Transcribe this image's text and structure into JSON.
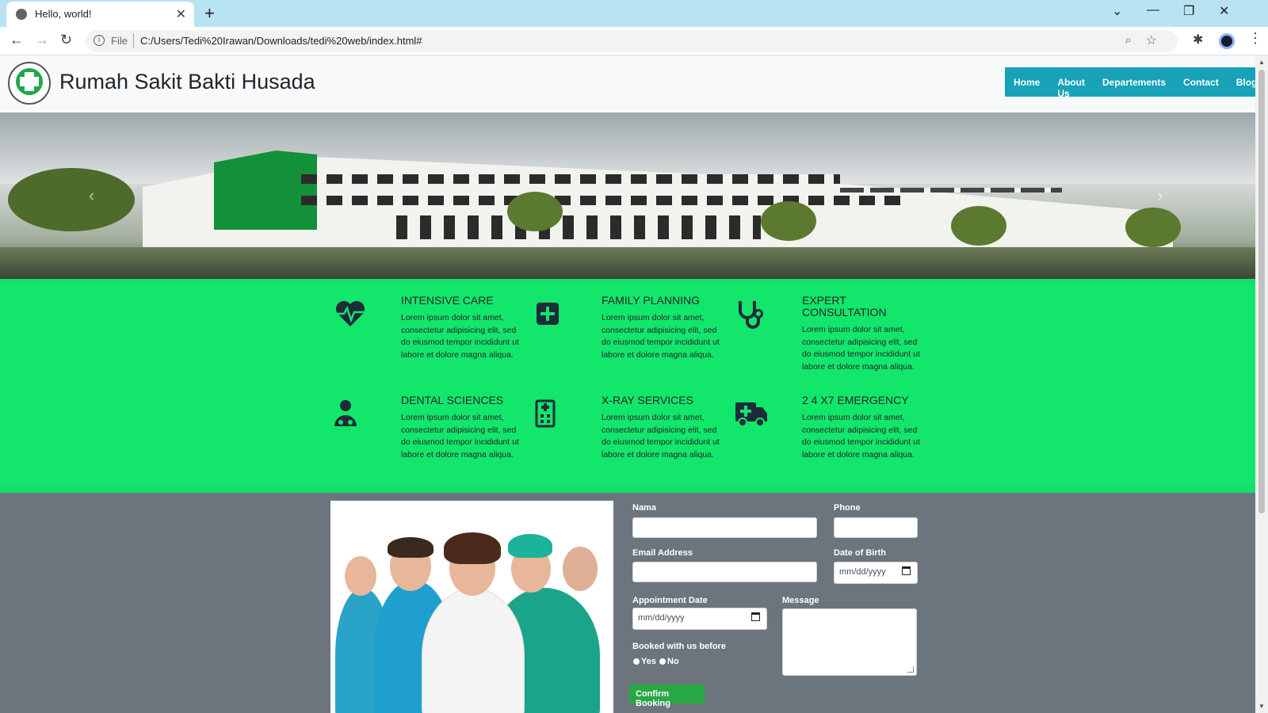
{
  "browser": {
    "tab_title": "Hello, world!",
    "new_tab": "+",
    "scheme": "File",
    "url": "C:/Users/Tedi%20Irawan/Downloads/tedi%20web/index.html#"
  },
  "site": {
    "brand": "Rumah Sakit Bakti Husada",
    "nav": [
      "Home",
      "About Us",
      "Departements",
      "Contact",
      "Blog"
    ]
  },
  "services": [
    {
      "title": "INTENSIVE CARE",
      "icon": "heartbeat-icon",
      "desc": "Lorem ipsum dolor sit amet, consectetur adipisicing elit, sed do eiusmod tempor incididunt ut labore et dolore magna aliqua."
    },
    {
      "title": "FAMILY PLANNING",
      "icon": "plus-square-icon",
      "desc": "Lorem ipsum dolor sit amet, consectetur adipisicing elit, sed do eiusmod tempor incididunt ut labore et dolore magna aliqua."
    },
    {
      "title": "EXPERT CONSULTATION",
      "icon": "stethoscope-icon",
      "desc": "Lorem ipsum dolor sit amet, consectetur adipisicing elit, sed do eiusmod tempor incididunt ut labore et dolore magna aliqua."
    },
    {
      "title": "DENTAL SCIENCES",
      "icon": "user-doctor-icon",
      "desc": "Lorem ipsum dolor sit amet, consectetur adipisicing elit, sed do eiusmod tempor incididunt ut labore et dolore magna aliqua."
    },
    {
      "title": "X-RAY SERVICES",
      "icon": "hospital-icon",
      "desc": "Lorem ipsum dolor sit amet, consectetur adipisicing elit, sed do eiusmod tempor incididunt ut labore et dolore magna aliqua."
    },
    {
      "title": "2 4 X7 EMERGENCY",
      "icon": "ambulance-icon",
      "desc": "Lorem ipsum dolor sit amet, consectetur adipisicing elit, sed do eiusmod tempor incididunt ut labore et dolore magna aliqua."
    }
  ],
  "form": {
    "name_label": "Nama",
    "phone_label": "Phone",
    "email_label": "Email Address",
    "dob_label": "Date of Birth",
    "dob_placeholder": "mm/dd/yyyy",
    "appt_label": "Appointment Date",
    "appt_placeholder": "mm/dd/yyyy",
    "message_label": "Message",
    "booked_label": "Booked with us before",
    "yes": "Yes",
    "no": "No",
    "submit": "Confirm Booking"
  },
  "colors": {
    "nav_bg": "#17a2b8",
    "services_bg": "#12e66b",
    "booking_bg": "#6c757d",
    "confirm_bg": "#28a745"
  }
}
